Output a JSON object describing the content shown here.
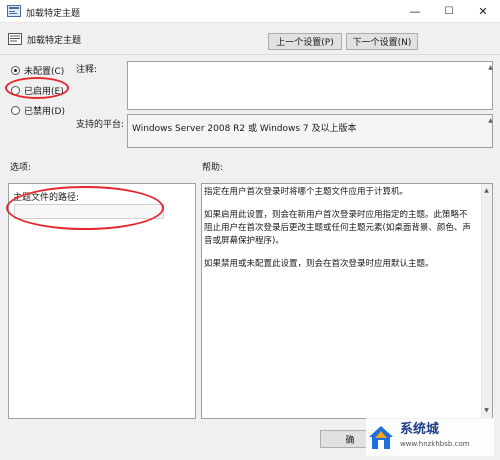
{
  "window": {
    "title": "加载特定主题",
    "icon": "policy-app-icon",
    "controls": {
      "minimize": "—",
      "maximize": "☐",
      "close": "✕"
    }
  },
  "header": {
    "title": "加载特定主题",
    "prev_button": "上一个设置(P)",
    "next_button": "下一个设置(N)"
  },
  "state_options": [
    {
      "label": "未配置(C)",
      "selected": true
    },
    {
      "label": "已启用(E)",
      "selected": false
    },
    {
      "label": "已禁用(D)",
      "selected": false
    }
  ],
  "comment": {
    "label": "注释:",
    "value": ""
  },
  "platform": {
    "label": "支持的平台:",
    "value": "Windows Server 2008 R2 或 Windows 7 及以上版本"
  },
  "options": {
    "section_label": "选项:",
    "path_label": "主题文件的路径:",
    "path_value": ""
  },
  "help": {
    "section_label": "帮助:",
    "paragraphs": [
      "指定在用户首次登录时将哪个主题文件应用于计算机。",
      "如果启用此设置，则会在新用户首次登录时应用指定的主题。此策略不阻止用户在首次登录后更改主题或任何主题元素(如桌面背景、颜色、声音或屏幕保护程序)。",
      "如果禁用或未配置此设置，则会在首次登录时应用默认主题。"
    ]
  },
  "footer": {
    "ok_button": "确"
  },
  "watermark": {
    "site": "系统城",
    "url": "www.hnzkhbsb.com"
  },
  "colors": {
    "annotation_red": "#e3282f",
    "button_face": "#e1e1e1"
  }
}
